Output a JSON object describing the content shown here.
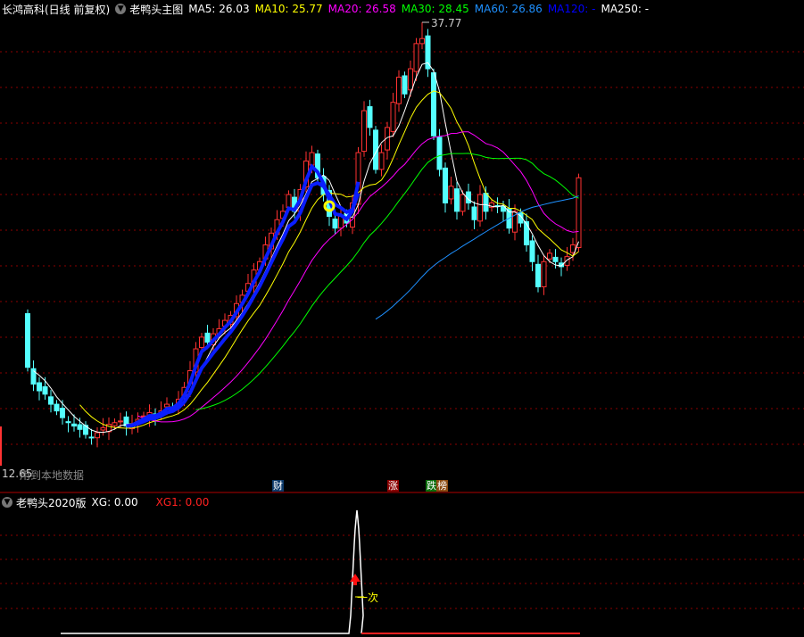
{
  "header": {
    "stock": "长鸿高科(日线 前复权)",
    "indicator": "老鸭头主图",
    "ma5": "MA5: 26.03",
    "ma10": "MA10: 25.77",
    "ma20": "MA20: 26.58",
    "ma30": "MA30: 28.45",
    "ma60": "MA60: 26.86",
    "ma120": "MA120: -",
    "ma250": "MA250: -"
  },
  "colors": {
    "ma5": "#ffffff",
    "ma10": "#ffff00",
    "ma20": "#ff00ff",
    "ma30": "#00ff00",
    "ma60": "#1e90ff",
    "ma120": "#0000ff",
    "up": "#ff3232",
    "down": "#54ffff",
    "grid": "#8b0000",
    "duck": "#0a1eff"
  },
  "price_high_label": "37.77",
  "price_low_label": "12.65",
  "status_text": "用到本地数据",
  "markers": {
    "cai": "财",
    "zhang": "涨",
    "die": "跌",
    "bang": "榜"
  },
  "sub": {
    "title": "老鸭头2020版",
    "xg": "XG: 0.00",
    "xg1": "XG1: 0.00",
    "signal": "一次"
  },
  "chart_data": {
    "type": "candlestick",
    "high": 37.77,
    "low": 12.65,
    "first_open": 20.4,
    "closes": [
      17.2,
      16.2,
      15.8,
      15.6,
      15.0,
      14.6,
      14.2,
      13.9,
      13.7,
      13.5,
      13.2,
      13.0,
      13.3,
      13.6,
      13.8,
      13.9,
      14.0,
      13.7,
      13.8,
      14.1,
      14.3,
      14.5,
      14.3,
      14.6,
      15.0,
      14.8,
      15.3,
      16.0,
      17.0,
      18.3,
      19.0,
      18.7,
      19.2,
      19.5,
      20.0,
      20.3,
      21.0,
      21.5,
      22.2,
      23.0,
      23.5,
      24.5,
      25.2,
      26.0,
      26.5,
      27.5,
      26.5,
      27.8,
      29.5,
      30.0,
      28.5,
      27.5,
      26.2,
      25.5,
      26.2,
      25.8,
      27.0,
      30.0,
      32.5,
      31.5,
      29.0,
      30.0,
      31.5,
      33.0,
      34.5,
      33.5,
      35.0,
      36.5,
      36.8,
      35.0,
      31.0,
      29.0,
      27.0,
      28.0,
      26.5,
      27.5,
      27.0,
      26.0,
      27.5,
      26.5,
      27.0,
      26.8,
      26.5,
      25.5,
      26.5,
      25.8,
      24.5,
      23.5,
      22.0,
      23.5,
      24.0,
      23.5,
      23.2,
      23.8,
      24.5,
      28.5
    ]
  }
}
